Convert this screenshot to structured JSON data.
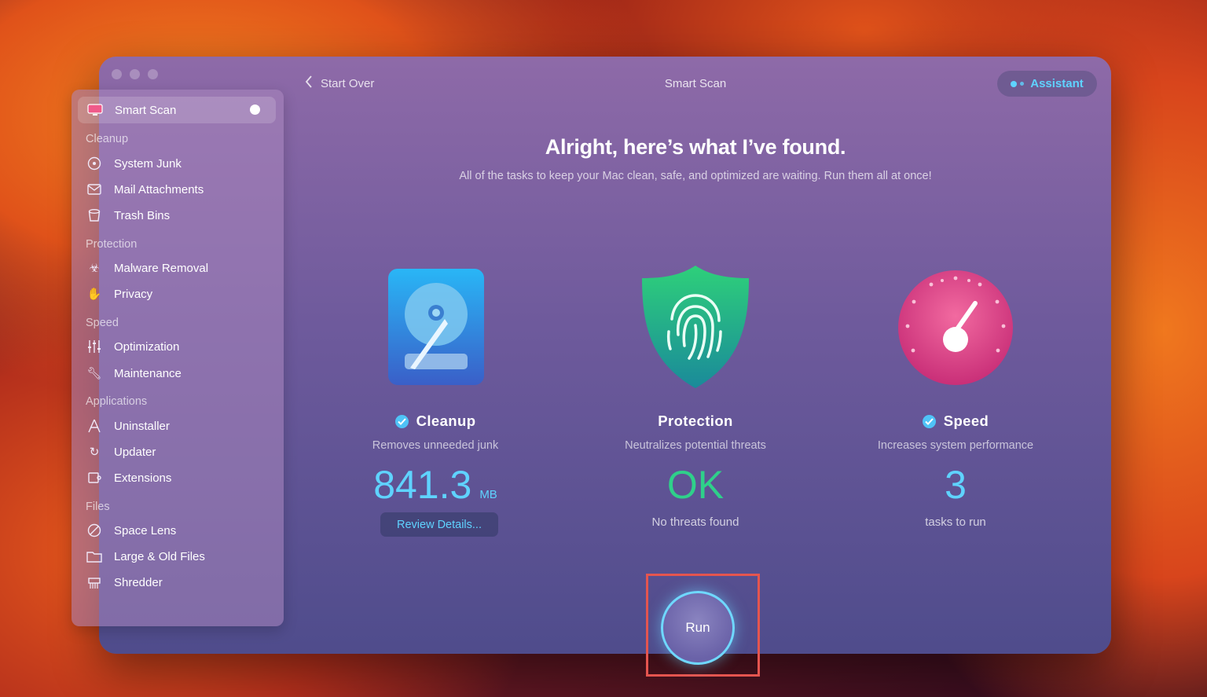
{
  "window": {
    "title": "Smart Scan",
    "back_label": "Start Over",
    "assistant_label": "Assistant"
  },
  "sidebar": {
    "active": {
      "label": "Smart Scan"
    },
    "sections": [
      {
        "title": "Cleanup",
        "items": [
          {
            "label": "System Junk"
          },
          {
            "label": "Mail Attachments"
          },
          {
            "label": "Trash Bins"
          }
        ]
      },
      {
        "title": "Protection",
        "items": [
          {
            "label": "Malware Removal"
          },
          {
            "label": "Privacy"
          }
        ]
      },
      {
        "title": "Speed",
        "items": [
          {
            "label": "Optimization"
          },
          {
            "label": "Maintenance"
          }
        ]
      },
      {
        "title": "Applications",
        "items": [
          {
            "label": "Uninstaller"
          },
          {
            "label": "Updater"
          },
          {
            "label": "Extensions"
          }
        ]
      },
      {
        "title": "Files",
        "items": [
          {
            "label": "Space Lens"
          },
          {
            "label": "Large & Old Files"
          },
          {
            "label": "Shredder"
          }
        ]
      }
    ]
  },
  "main": {
    "heading": "Alright, here’s what I’ve found.",
    "subheading": "All of the tasks to keep your Mac clean, safe, and optimized are waiting. Run them all at once!",
    "cards": [
      {
        "title": "Cleanup",
        "description": "Removes unneeded junk",
        "value": "841.3",
        "unit": "MB",
        "action": "Review Details...",
        "value_color": "#5fd3ff",
        "checked": true
      },
      {
        "title": "Protection",
        "description": "Neutralizes potential threats",
        "value": "OK",
        "note": "No threats found",
        "value_color": "#2fd08a",
        "checked": false
      },
      {
        "title": "Speed",
        "description": "Increases system performance",
        "value": "3",
        "note": "tasks to run",
        "value_color": "#5fd3ff",
        "checked": true
      }
    ],
    "run_label": "Run"
  }
}
